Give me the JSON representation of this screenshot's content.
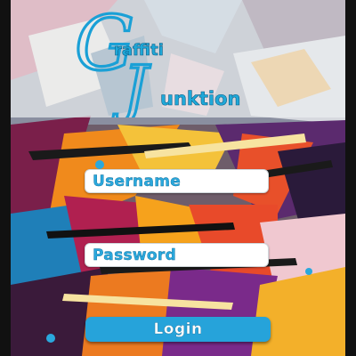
{
  "app": {
    "logo_line1": "raffiti",
    "logo_line2": "unktion",
    "logo_initial1": "G",
    "logo_initial2": "J"
  },
  "form": {
    "username_placeholder": "Username",
    "password_placeholder": "Password",
    "login_label": "Login"
  },
  "colors": {
    "accent": "#26a3da",
    "field_bg": "#ffffff",
    "header_overlay": "#ebeef0"
  }
}
